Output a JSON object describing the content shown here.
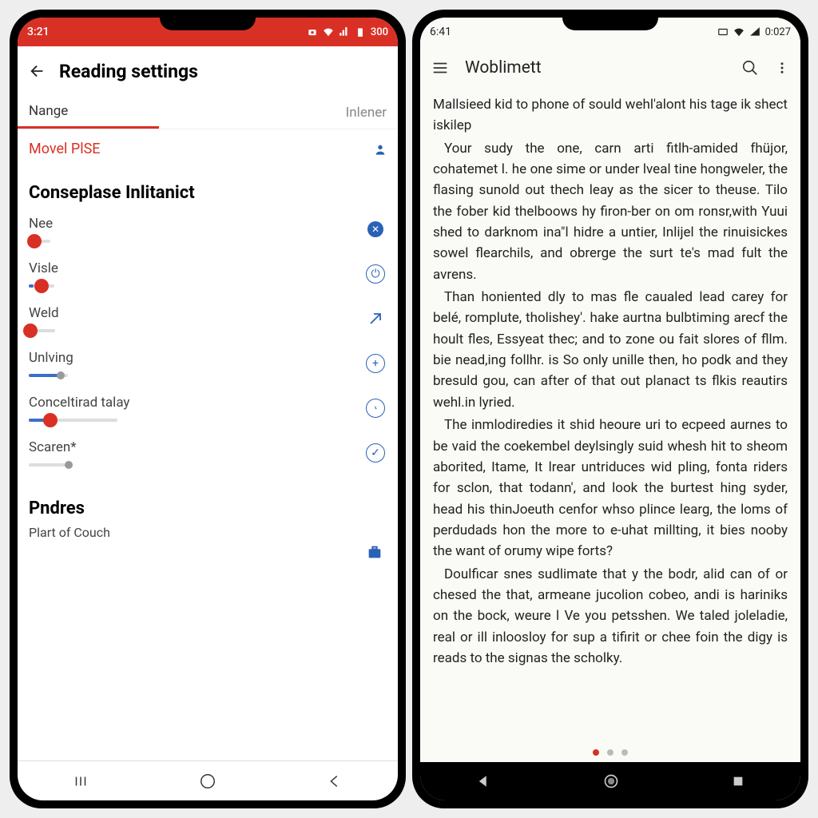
{
  "left": {
    "status": {
      "time": "3:21",
      "batt": "300"
    },
    "header": {
      "title": "Reading settings"
    },
    "tabs": {
      "active": "Nange",
      "other": "Inlener"
    },
    "movel": "Movel PlSE",
    "section": "Conseplase Inlitanict",
    "sliders": [
      {
        "label": "Nee",
        "pos": 28,
        "fill": 28,
        "thumb": "red",
        "icon": "dot-fill"
      },
      {
        "label": "Visle",
        "pos": 48,
        "fill": 18,
        "thumb": "red",
        "icon": "power"
      },
      {
        "label": "Weld",
        "pos": 7,
        "fill": 7,
        "thumb": "red",
        "icon": "arrow"
      },
      {
        "label": "Unlving",
        "pos": 82,
        "fill": 82,
        "thumb": "gray",
        "icon": "plus"
      },
      {
        "label": "Conceltirad talay",
        "pos": 24,
        "fill": 24,
        "thumb": "red",
        "icon": "clock"
      },
      {
        "label": "Scaren*",
        "pos": 96,
        "fill": 0,
        "thumb": "gray",
        "icon": "check"
      }
    ],
    "pndres": {
      "title": "Pndres",
      "sub": "Plart of Couch"
    }
  },
  "right": {
    "status": {
      "time": "6:41",
      "batt": "0:027"
    },
    "header": {
      "title": "Woblimett"
    },
    "p1": "Mallsieed kid to phone of sould wehl'alont his tage ik shect iskilep",
    "p2": "Your sudy the one, carn arti fitlh-amided fhüjor, cohatemet l. he one sime or under lveal tine hongweler, the flasing sunold out thech leay as the sicer to theuse. Tilo the fober kid thelboows hy firon-ber on om ronsr,with Yuui shed to darknom ina\"l hidre a untier, Inlijel the rinuisickes sowel flearchils, and obrerge the surt te's mad fult the avrens.",
    "p3": "Than honiented dly to mas fle caualed lead carey for belé, romplute, tholishey'. hake aurtna bulbtiming arecf the hoult fles, Essyeat thec; and to zone ou fait slores of fllm. bie nead,ing follhr. is So only unille then, ho podk and they bresuld gou, can after of that out planact ts flkis reautirs wehl.in lyried.",
    "p4": "The inmlodiredies it shid heoure uri to ecpeed aurnes to be vaid the coekembel deylsingly suid whesh hit to sheom aborited, Itame, It lrear untriduces wid pling, fonta riders for sclon, that todann', and look the burtest hing syder, head his thinJoeuth cenfor whso plince learg, the loms of perdudads hon the more to e-uhat millting, it bies nooby the want of orumy wipe forts?",
    "p5": "Doulficar snes sudlimate that y the bodr, alid can of or chesed the that, armeane jucolion cobeo, andi is hariniks on the bock, weure l Ve you petsshen. We taled joleladie, real or ill inloosloy for sup a tifirit or chee foin the digy is reads to the signas the scholky."
  }
}
